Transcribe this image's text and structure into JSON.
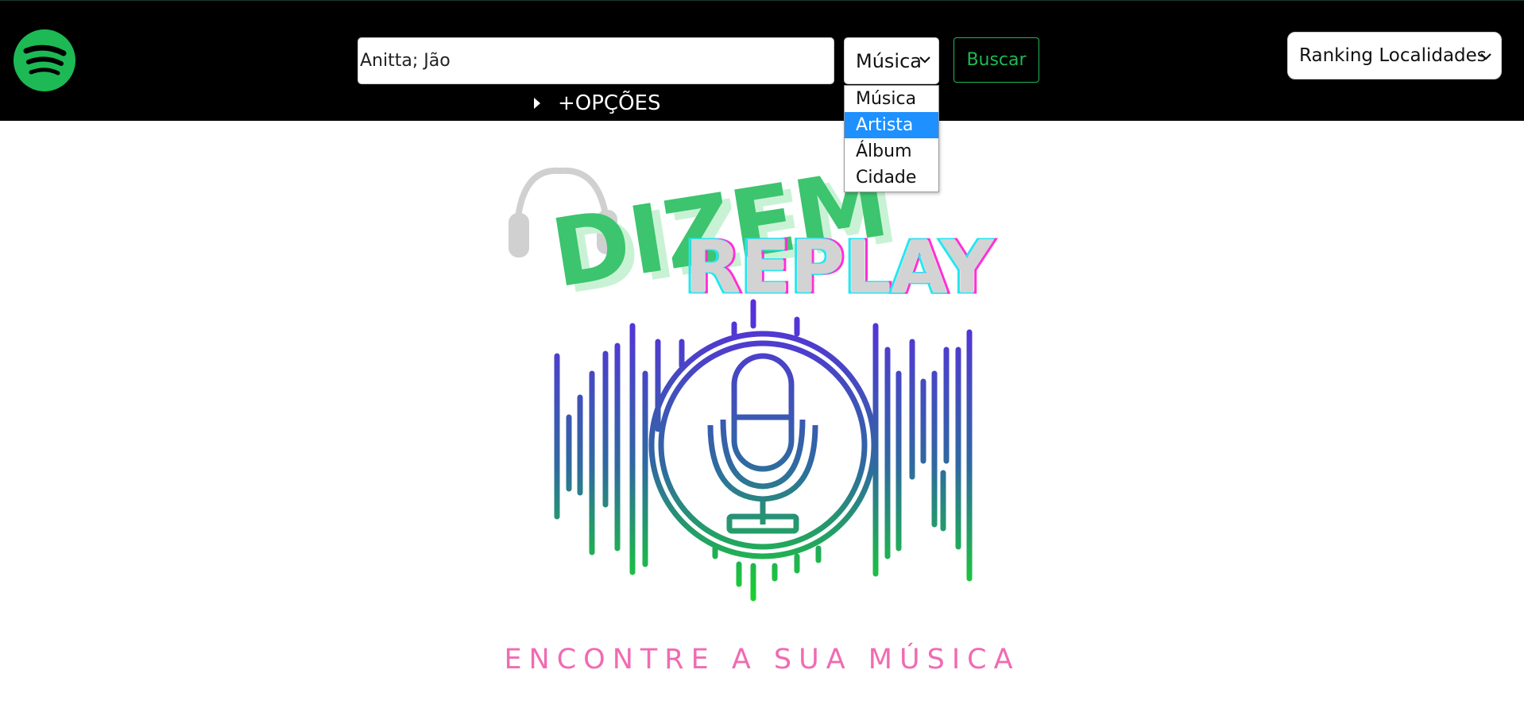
{
  "header": {
    "search": {
      "value": "Anitta; Jão",
      "placeholder": ""
    },
    "type_select": {
      "selected": "Música",
      "options": [
        "Música",
        "Artista",
        "Álbum",
        "Cidade"
      ],
      "highlighted": "Artista"
    },
    "search_button_label": "Buscar",
    "ranking_select": {
      "selected": "Ranking Localidades"
    },
    "options_toggle_label": "+OPÇÕES"
  },
  "hero": {
    "logo_word_1": "DIZEM",
    "logo_word_2": "REPLAY",
    "tagline": "ENCONTRE A SUA MÚSICA"
  },
  "colors": {
    "brand_green": "#1db954",
    "logo_green": "#3cc46e",
    "tagline_pink": "#f06bb3",
    "gradient_top": "#5a2be0",
    "gradient_bottom": "#18d62a",
    "highlight_blue": "#1e90ff"
  },
  "icons": {
    "logo": "spotify-icon",
    "headphones": "headphones-icon",
    "microphone": "microphone-icon",
    "select_chevron": "chevron-down-icon",
    "toggle": "caret-right-icon"
  }
}
